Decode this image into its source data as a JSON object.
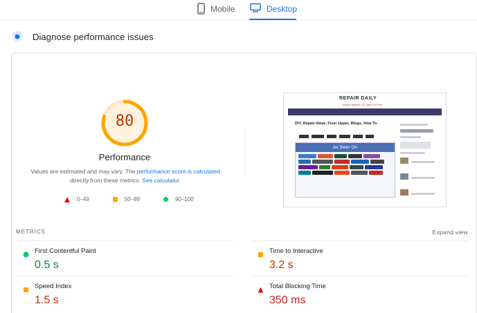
{
  "tabs": [
    {
      "label": "Mobile",
      "icon": "phone-icon",
      "active": false
    },
    {
      "label": "Desktop",
      "icon": "monitor-icon",
      "active": true
    }
  ],
  "header": {
    "title": "Diagnose performance issues"
  },
  "score": {
    "value": "80",
    "label": "Performance",
    "ratio": 0.8,
    "color": "#ffa400"
  },
  "description": {
    "text1": "Values are estimated and may vary. The ",
    "link1": "performance score is calculated",
    "text2": "directly from these metrics. ",
    "link2": "See calculator."
  },
  "legend": [
    {
      "range": "0–49",
      "shape": "triangle",
      "color": "#eb0f00"
    },
    {
      "range": "50–89",
      "shape": "square",
      "color": "#ffa400"
    },
    {
      "range": "90–100",
      "shape": "circle",
      "color": "#0cce6b"
    }
  ],
  "preview": {
    "site_logo": "REPAIR DAILY",
    "site_tagline": "Search Millions Of Jobs For Free",
    "heading": "DIY, Repair Ideas, Fixer Upper, Blogs, How To",
    "box_title": "As Seen On"
  },
  "metrics": {
    "heading": "METRICS",
    "expand_label": "Expand view",
    "items": [
      {
        "name": "First Contentful Paint",
        "value": "0.5 s",
        "status": "good"
      },
      {
        "name": "Time to Interactive",
        "value": "3.2 s",
        "status": "average"
      },
      {
        "name": "Speed Index",
        "value": "1.5 s",
        "status": "average"
      },
      {
        "name": "Total Blocking Time",
        "value": "350 ms",
        "status": "poor"
      }
    ]
  }
}
